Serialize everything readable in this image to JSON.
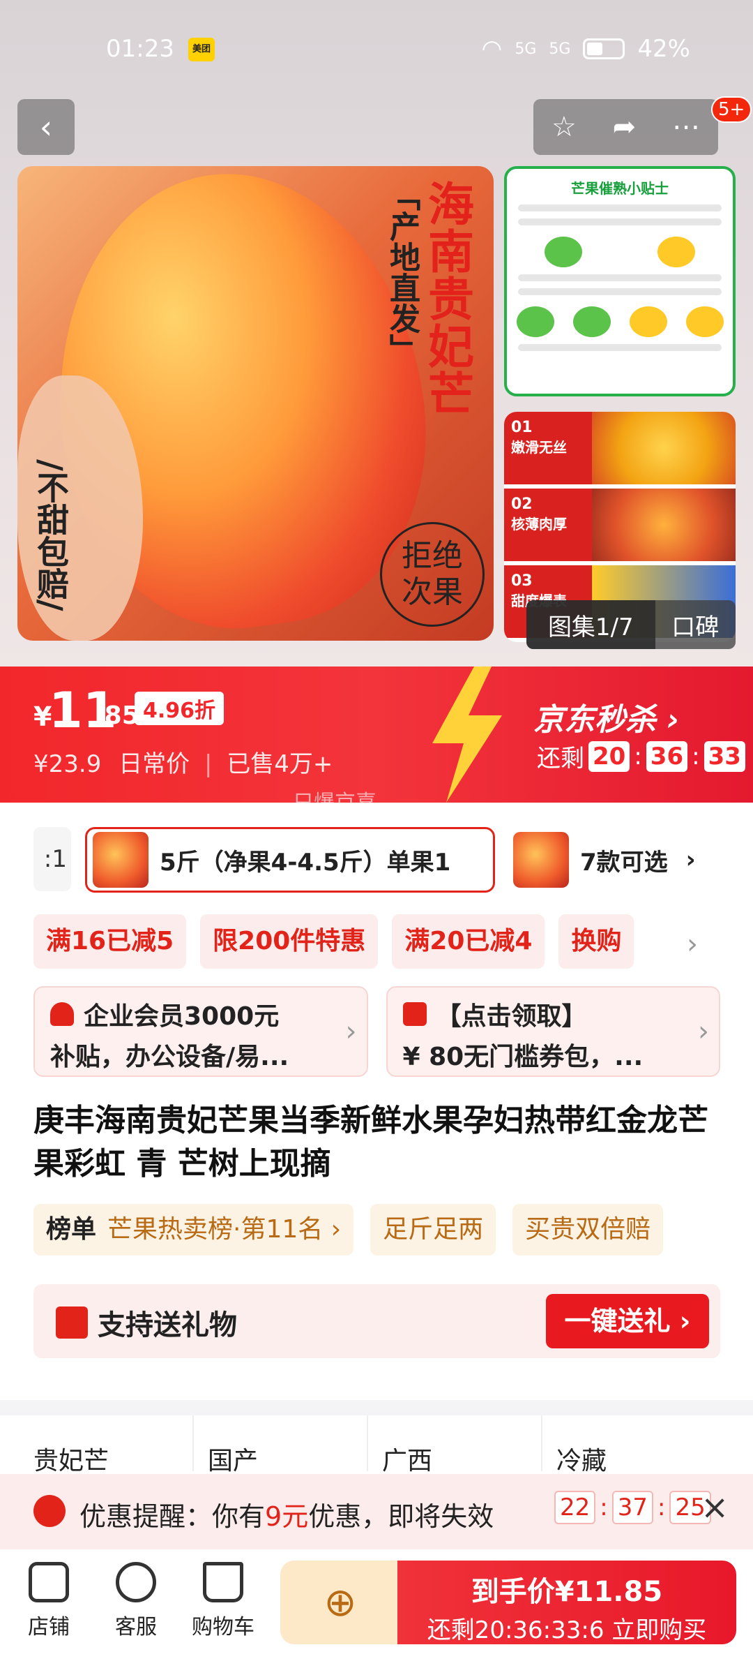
{
  "status_bar": {
    "time": "01:23",
    "app_badge": "美团",
    "network1": "5G",
    "network2": "5G",
    "battery": "42%"
  },
  "top_nav": {
    "back_icon": "chevron-left-icon",
    "favorite_icon": "star-icon",
    "share_icon": "share-icon",
    "more_icon": "more-icon",
    "cart_badge": "5+"
  },
  "hero": {
    "title_main": "海南贵妃芒",
    "title_sub": "「产地直发」",
    "guarantee": "/不甜包赔/",
    "stamp": "拒绝次果",
    "tips_title": "芒果催熟小贴士",
    "features": [
      {
        "num": "01",
        "label": "嫩滑无丝"
      },
      {
        "num": "02",
        "label": "核薄肉厚"
      },
      {
        "num": "03",
        "label": "甜度爆表"
      }
    ],
    "gallery_label": "图集1/7",
    "review_label": "口碑"
  },
  "price": {
    "currency": "¥",
    "integer": "11",
    "decimal": ".85",
    "discount": "4.96折",
    "original": "¥23.9",
    "original_label": "日常价",
    "sold": "已售4万+",
    "seckill": "京东秒杀",
    "countdown_label": "还剩",
    "countdown": [
      "20",
      "36",
      "33"
    ],
    "watermark": "只爆京喜"
  },
  "sku": {
    "edge_label": ":1",
    "selected": "5斤（净果4-4.5斤）单果1",
    "more": "7款可选"
  },
  "promo_tags": [
    "满16已减5",
    "限200件特惠",
    "满20已减4",
    "换购"
  ],
  "coupons": [
    {
      "line1": "企业会员3000元",
      "line2": "补贴，办公设备/易..."
    },
    {
      "line1": "【点击领取】",
      "line2": "¥ 80无门槛券包，..."
    }
  ],
  "product_title": "庚丰海南贵妃芒果当季新鲜水果孕妇热带红金龙芒果彩虹 青 芒树上现摘",
  "badges": {
    "rank_label": "榜单",
    "rank_value": "芒果热卖榜·第11名 ›",
    "b2": "足斤足两",
    "b3": "买贵双倍赔"
  },
  "gift": {
    "label": "支持送礼物",
    "button": "一键送礼 ›"
  },
  "params": [
    "贵妃芒",
    "国产",
    "广西",
    "冷藏"
  ],
  "reminder": {
    "prefix": "优惠提醒：你有",
    "amount": "9元",
    "suffix": "优惠，即将失效",
    "countdown": [
      "22",
      "37",
      "25"
    ]
  },
  "bottom_bar": {
    "store": "店铺",
    "service": "客服",
    "cart": "购物车",
    "final_price_label": "到手价¥11.85",
    "buy_line": "还剩20:36:33:6 立即购买"
  }
}
